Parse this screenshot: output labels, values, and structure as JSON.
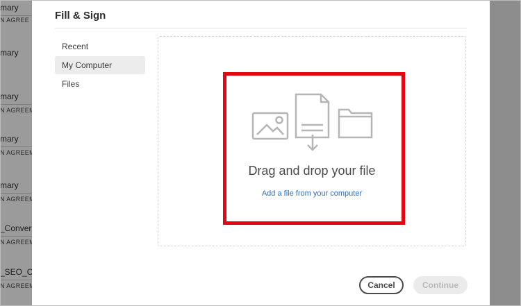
{
  "background_list": {
    "items": [
      {
        "title": "mary",
        "subtitle": "N AGREE"
      },
      {
        "title": "mary",
        "subtitle": ""
      },
      {
        "title": "mary",
        "subtitle": "N AGREEM"
      },
      {
        "title": "mary",
        "subtitle": "N AGREEM"
      },
      {
        "title": "mary",
        "subtitle": "N AGREEM"
      },
      {
        "title": "_Convert",
        "subtitle": "N AGREEM"
      },
      {
        "title": "_SEO_Op",
        "subtitle": "N AGREEM"
      }
    ]
  },
  "modal": {
    "title": "Fill & Sign",
    "sidebar": [
      {
        "label": "Recent",
        "active": false
      },
      {
        "label": "My Computer",
        "active": true
      },
      {
        "label": "Files",
        "active": false
      }
    ],
    "dropzone": {
      "heading": "Drag and drop your file",
      "link": "Add a file from your computer",
      "icons": [
        "image-icon",
        "document-upload-icon",
        "folder-icon"
      ]
    },
    "buttons": {
      "cancel": "Cancel",
      "continue": "Continue"
    }
  },
  "colors": {
    "highlight": "#e4070f",
    "link": "#2d6dc4"
  }
}
